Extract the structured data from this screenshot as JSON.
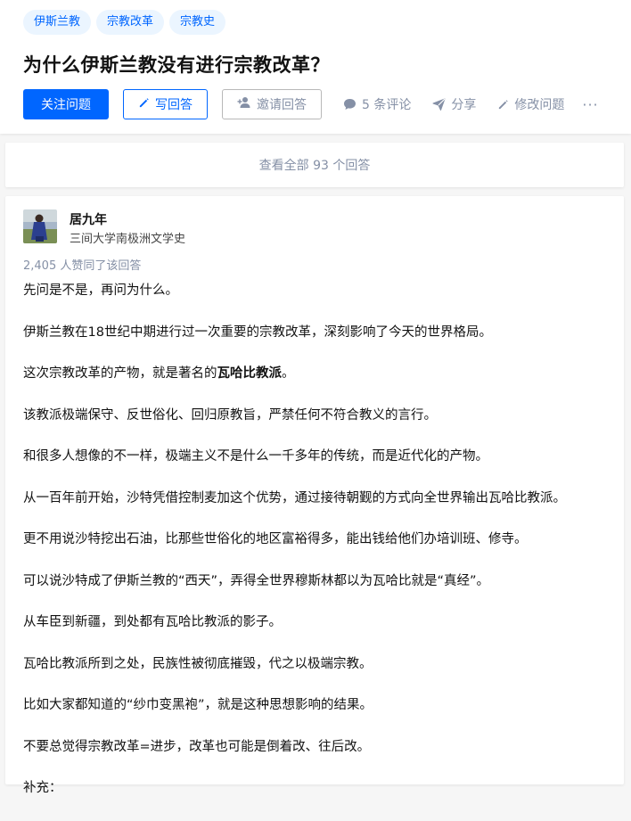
{
  "question": {
    "topics": [
      "伊斯兰教",
      "宗教改革",
      "宗教史"
    ],
    "title": "为什么伊斯兰教没有进行宗教改革？",
    "follow_label": "关注问题",
    "write_answer_label": "写回答",
    "invite_label": "邀请回答",
    "comments_label": "5 条评论",
    "share_label": "分享",
    "edit_label": "修改问题",
    "more_label": "···"
  },
  "view_all_label": "查看全部 93 个回答",
  "answer": {
    "author_name": "居九年",
    "author_bio": "三间大学南极洲文学史",
    "votes_text": "2,405 人赞同了该回答",
    "paragraphs": [
      "先问是不是，再问为什么。",
      "伊斯兰教在18世纪中期进行过一次重要的宗教改革，深刻影响了今天的世界格局。",
      "这次宗教改革的产物，就是著名的",
      "该教派极端保守、反世俗化、回归原教旨，严禁任何不符合教义的言行。",
      "和很多人想像的不一样，极端主义不是什么一千多年的传统，而是近代化的产物。",
      "从一百年前开始，沙特凭借控制麦加这个优势，通过接待朝觐的方式向全世界输出瓦哈比教派。",
      "更不用说沙特挖出石油，比那些世俗化的地区富裕得多，能出钱给他们办培训班、修寺。",
      "可以说沙特成了伊斯兰教的“西天”，弄得全世界穆斯林都以为瓦哈比就是“真经”。",
      "从车臣到新疆，到处都有瓦哈比教派的影子。",
      "瓦哈比教派所到之处，民族性被彻底摧毁，代之以极端宗教。",
      "比如大家都知道的“纱巾变黑袍”，就是这种思想影响的结果。",
      "不要总觉得宗教改革=进步，改革也可能是倒着改、往后改。",
      "补充："
    ],
    "bold_term": "瓦哈比教派",
    "bold_suffix": "。"
  },
  "colors": {
    "brand_blue": "#0066ff",
    "tag_bg": "#ebf5ff",
    "muted": "#8590a6"
  },
  "icons": [
    "pencil-icon",
    "add-user-icon",
    "comment-icon",
    "share-icon",
    "edit-icon"
  ]
}
